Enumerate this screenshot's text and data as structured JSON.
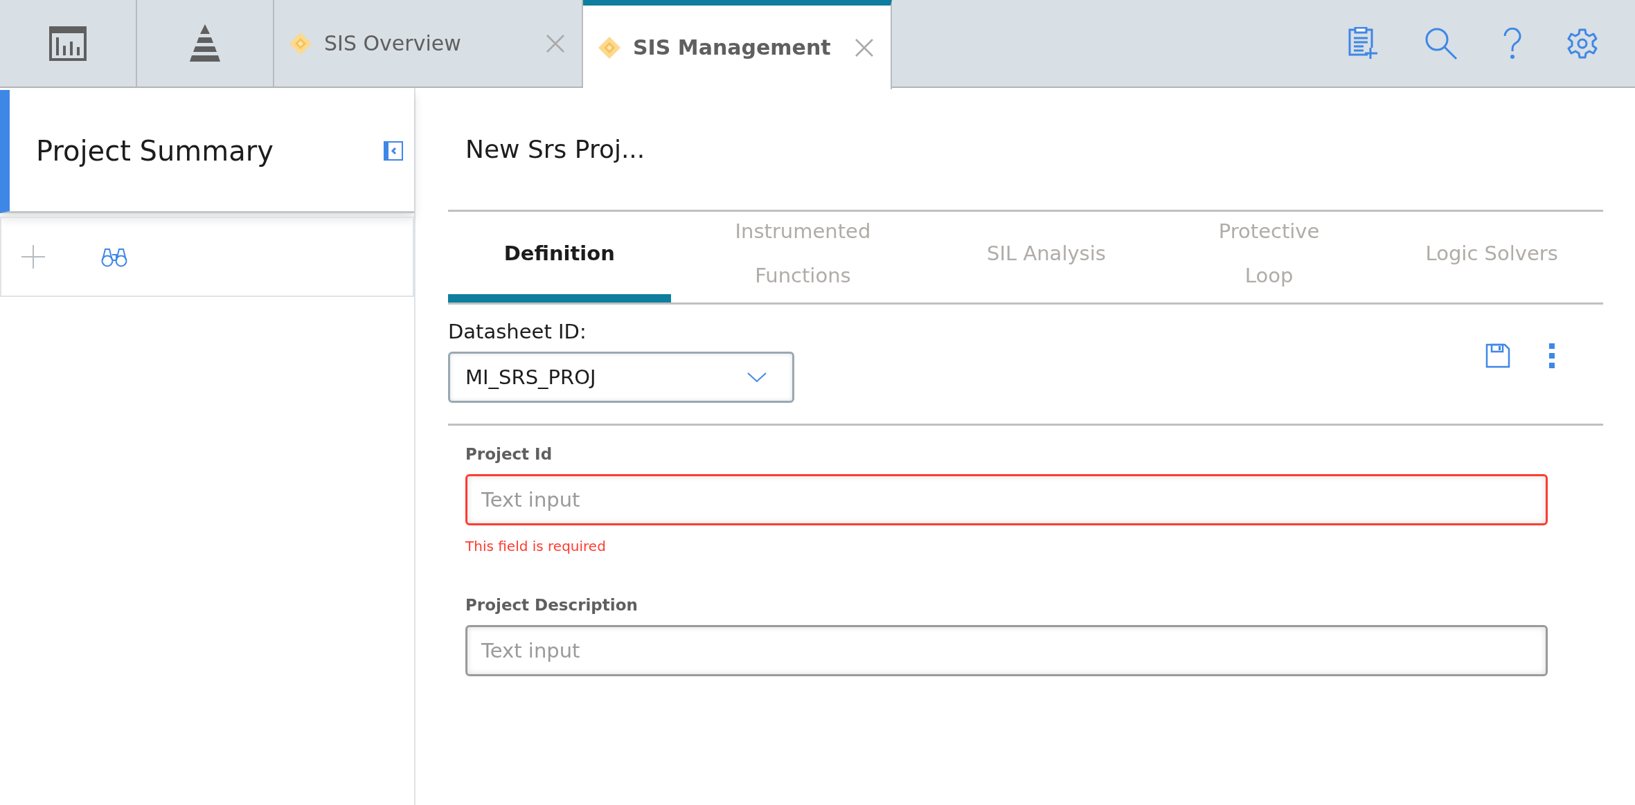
{
  "top_tabs": [
    {
      "kind": "dashboard"
    },
    {
      "kind": "pyramid"
    },
    {
      "kind": "document",
      "label": "SIS Overview",
      "selected": false
    },
    {
      "kind": "document",
      "label": "SIS Management",
      "selected": true
    }
  ],
  "sidebar": {
    "title": "Project Summary"
  },
  "page": {
    "title": "New Srs Proj..."
  },
  "tabs": [
    {
      "label": "Definition",
      "selected": true
    },
    {
      "label": "Instrumented Functions",
      "selected": false
    },
    {
      "label": "SIL Analysis",
      "selected": false
    },
    {
      "label": "Protective Loop",
      "selected": false
    },
    {
      "label": "Logic Solvers",
      "selected": false
    }
  ],
  "datasheet": {
    "label": "Datasheet ID:",
    "value": "MI_SRS_PROJ"
  },
  "fields": [
    {
      "label": "Project Id",
      "placeholder": "Text input",
      "error": "This field is required"
    },
    {
      "label": "Project Description",
      "placeholder": "Text input"
    }
  ]
}
